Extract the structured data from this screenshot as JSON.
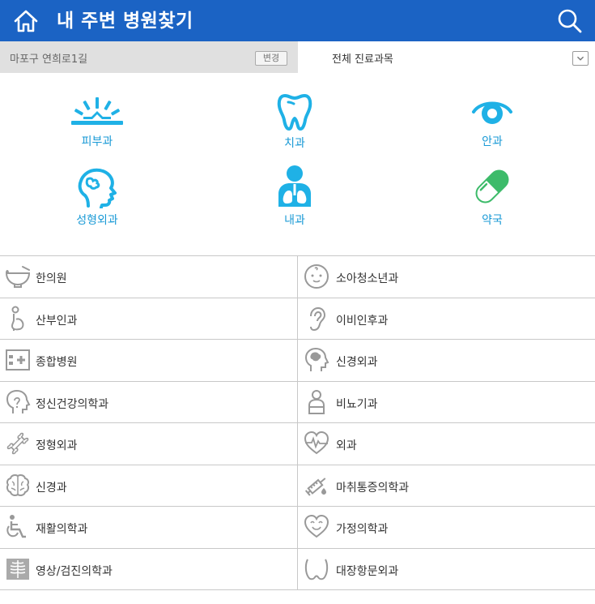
{
  "header": {
    "title": "내 주변 병원찾기"
  },
  "filter": {
    "location": "마포구 연희로1길",
    "change_label": "변경",
    "department": "전체 진료과목"
  },
  "favorites": [
    {
      "label": "피부과",
      "icon": "dermatology-icon"
    },
    {
      "label": "치과",
      "icon": "tooth-icon"
    },
    {
      "label": "안과",
      "icon": "eye-icon"
    },
    {
      "label": "성형외과",
      "icon": "plastic-surgery-icon"
    },
    {
      "label": "내과",
      "icon": "internal-medicine-icon"
    },
    {
      "label": "약국",
      "icon": "pill-icon"
    }
  ],
  "departments": [
    {
      "label": "한의원",
      "icon": "herbal-bowl-icon"
    },
    {
      "label": "소아청소년과",
      "icon": "baby-face-icon"
    },
    {
      "label": "산부인과",
      "icon": "pregnant-icon"
    },
    {
      "label": "이비인후과",
      "icon": "ear-icon"
    },
    {
      "label": "종합병원",
      "icon": "hospital-icon"
    },
    {
      "label": "신경외과",
      "icon": "head-brain-icon"
    },
    {
      "label": "정신건강의학과",
      "icon": "head-profile-icon"
    },
    {
      "label": "비뇨기과",
      "icon": "person-icon"
    },
    {
      "label": "정형외과",
      "icon": "bone-icon"
    },
    {
      "label": "외과",
      "icon": "heart-pulse-icon"
    },
    {
      "label": "신경과",
      "icon": "brain-icon"
    },
    {
      "label": "마취통증의학과",
      "icon": "syringe-icon"
    },
    {
      "label": "재활의학과",
      "icon": "wheelchair-icon"
    },
    {
      "label": "가정의학과",
      "icon": "heart-smile-icon"
    },
    {
      "label": "영상/검진의학과",
      "icon": "xray-icon"
    },
    {
      "label": "대장항문외과",
      "icon": "colon-icon"
    }
  ],
  "colors": {
    "header": "#1b63c4",
    "accent": "#1a9ad6",
    "pill": "#3dbb6a",
    "line_icon": "#999999"
  }
}
